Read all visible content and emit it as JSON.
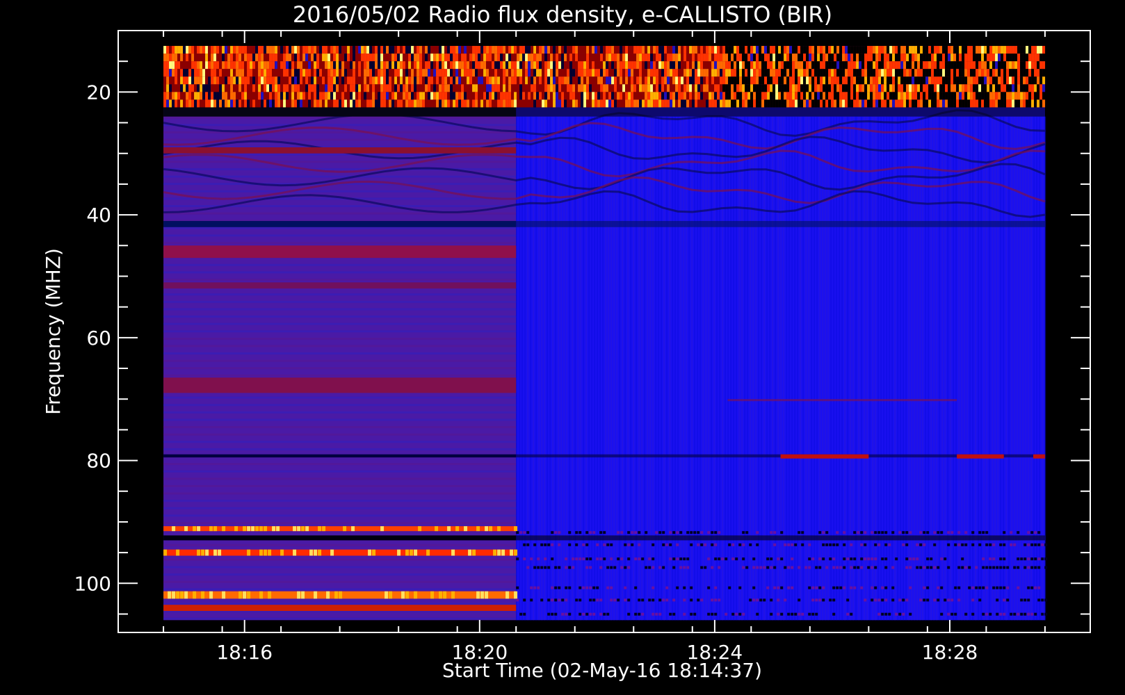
{
  "chart_data": {
    "type": "heatmap",
    "title": "2016/05/02  Radio flux density, e-CALLISTO (BIR)",
    "xlabel": "Start Time (02-May-16 18:14:37)",
    "ylabel": "Frequency (MHZ)",
    "x_ticks": [
      "18:16",
      "18:20",
      "18:24",
      "18:28"
    ],
    "x_tick_minutes": [
      1.38,
      5.38,
      9.38,
      13.38
    ],
    "x_range_minutes": [
      -0.77,
      15.77
    ],
    "data_x_range_minutes": [
      0.0,
      15.0
    ],
    "instrument_switch_minutes": 6.0,
    "y_ticks": [
      20,
      40,
      60,
      80,
      100
    ],
    "y_minor_ticks": [
      15,
      25,
      30,
      35,
      45,
      50,
      55,
      65,
      70,
      75,
      85,
      90,
      95,
      105
    ],
    "y_range": [
      10,
      108
    ],
    "data_y_range": [
      12.5,
      106
    ],
    "reversed_y": true,
    "colormap": [
      "#000000",
      "#0000ff",
      "#8b0000",
      "#ff3300",
      "#ffb000",
      "#ffff80"
    ],
    "band_rows": [
      {
        "mhz_from": 12.5,
        "mhz_to": 22.5,
        "level": "burst-noise",
        "color": "#ff5500"
      },
      {
        "mhz_from": 22.5,
        "mhz_to": 24,
        "level": "low",
        "color": "#050515"
      },
      {
        "mhz_from": 29,
        "mhz_to": 30,
        "level": "mid",
        "color": "#8b1030"
      },
      {
        "mhz_from": 41,
        "mhz_to": 42,
        "level": "low",
        "color": "#001060"
      },
      {
        "mhz_from": 45,
        "mhz_to": 47,
        "level": "mid",
        "color": "#90104a"
      },
      {
        "mhz_from": 51,
        "mhz_to": 52,
        "level": "mid",
        "color": "#70105e"
      },
      {
        "mhz_from": 66.5,
        "mhz_to": 69,
        "level": "mid",
        "color": "#80104d"
      },
      {
        "mhz_from": 79,
        "mhz_to": 79.5,
        "level": "low",
        "color": "#000040"
      },
      {
        "mhz_from": 90.7,
        "mhz_to": 91.5,
        "level": "high",
        "color": "#ff4000"
      },
      {
        "mhz_from": 92.2,
        "mhz_to": 93,
        "level": "low",
        "color": "#000010"
      },
      {
        "mhz_from": 94.5,
        "mhz_to": 95.5,
        "level": "high",
        "color": "#ff2a00"
      },
      {
        "mhz_from": 101.3,
        "mhz_to": 102.5,
        "level": "very-high",
        "color": "#ff6a00"
      },
      {
        "mhz_from": 103.5,
        "mhz_to": 104.5,
        "level": "high",
        "color": "#d02000"
      }
    ],
    "late_band_79_mhz_segments_minutes": [
      [
        10.5,
        12.0
      ],
      [
        13.5,
        14.3
      ],
      [
        14.8,
        15.0
      ]
    ],
    "colorbar": "none",
    "grid": false,
    "legend": "none"
  }
}
